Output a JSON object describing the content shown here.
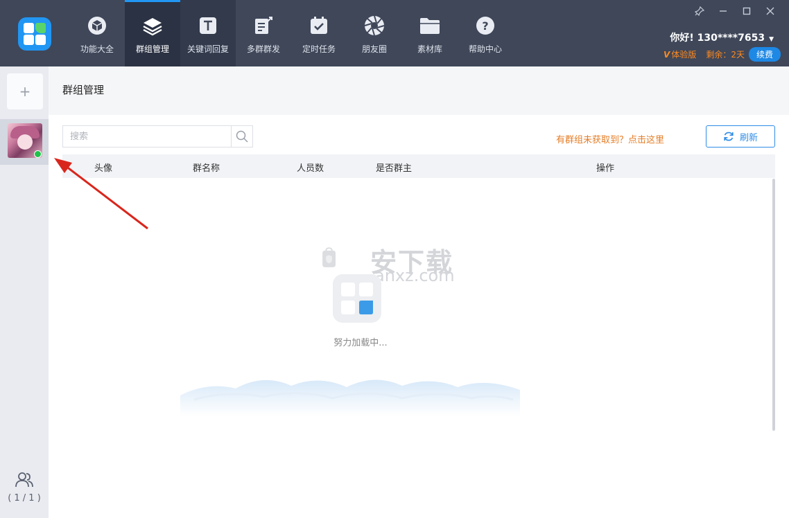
{
  "nav": {
    "items": [
      {
        "label": "功能大全",
        "icon": "cube-icon"
      },
      {
        "label": "群组管理",
        "icon": "layers-icon"
      },
      {
        "label": "关键词回复",
        "icon": "text-t-icon"
      },
      {
        "label": "多群群发",
        "icon": "broadcast-icon"
      },
      {
        "label": "定时任务",
        "icon": "calendar-check-icon"
      },
      {
        "label": "朋友圈",
        "icon": "aperture-icon"
      },
      {
        "label": "素材库",
        "icon": "folder-icon"
      },
      {
        "label": "帮助中心",
        "icon": "help-icon"
      }
    ]
  },
  "user": {
    "greeting": "你好! 130****7653",
    "version": "体验版",
    "remaining": "剩余：2天",
    "renew": "续费"
  },
  "sidebar": {
    "add": "+",
    "count": "( 1 / 1 )"
  },
  "main": {
    "title": "群组管理",
    "search_placeholder": "搜索",
    "missing_link": "有群组未获取到？点击这里",
    "refresh": "刷新",
    "columns": [
      "头像",
      "群名称",
      "人员数",
      "是否群主",
      "操作"
    ],
    "loading": "努力加载中..."
  },
  "watermark": {
    "word": "安下载",
    "url": "anxz.com"
  },
  "colors": {
    "topbar": "#3f4759",
    "accent": "#2196f3",
    "orange": "#e47d26",
    "online": "#1fc24a"
  }
}
